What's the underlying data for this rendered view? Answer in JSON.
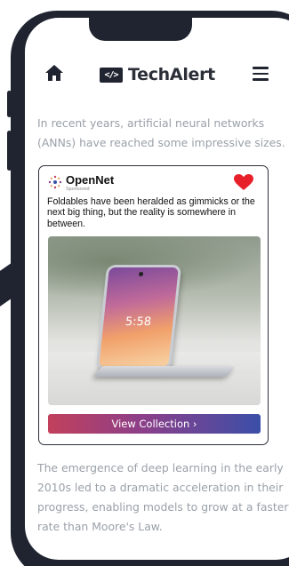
{
  "header": {
    "brand_logo_text": "</>",
    "brand_name": "TechAlert",
    "icons": [
      "home-icon",
      "menu-icon"
    ]
  },
  "article": {
    "intro": "In recent years, artificial neural networks (ANNs) have reached some impressive sizes.",
    "outro": "The emergence of deep learning in the early 2010s led to a dramatic acceleration in their progress, enabling models to grow at a faster rate than Moore's Law."
  },
  "ad": {
    "advertiser": "OpenNet",
    "sponsored_label": "Sponsored",
    "body": "Foldables have been heralded as gimmicks or the next big thing, but the reality is somewhere in between.",
    "image_time": "5:58",
    "cta_label": "View Collection ›",
    "favorite_color": "#e8202a"
  },
  "colors": {
    "frame": "#1f2430",
    "body_text": "#9aa0a8",
    "cta_gradient": [
      "#c2405c",
      "#8b3f8a",
      "#3b4fa8"
    ]
  }
}
